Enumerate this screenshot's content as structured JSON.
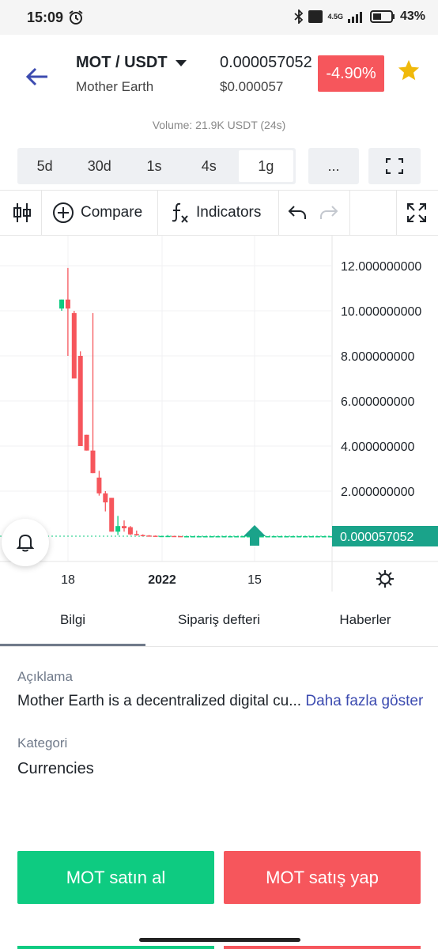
{
  "status": {
    "time": "15:09",
    "network": "4.5G",
    "battery": "43%"
  },
  "header": {
    "pair": "MOT / USDT",
    "name": "Mother Earth",
    "price": "0.000057052",
    "price_usd": "$0.000057",
    "change": "-4.90%",
    "volume": "Volume: 21.9K USDT (24s)"
  },
  "timeframes": [
    {
      "label": "5d"
    },
    {
      "label": "30d"
    },
    {
      "label": "1s"
    },
    {
      "label": "4s"
    },
    {
      "label": "1g",
      "active": true
    }
  ],
  "more_label": "...",
  "toolbar": {
    "compare": "Compare",
    "indicators": "Indicators"
  },
  "chart_data": {
    "type": "candlestick",
    "y_ticks": [
      "12.000000000",
      "10.000000000",
      "8.000000000",
      "6.000000000",
      "4.000000000",
      "2.000000000"
    ],
    "x_ticks": [
      "18",
      "2022",
      "15"
    ],
    "last_price_label": "0.000057052",
    "ylim": [
      0,
      12.8
    ],
    "candles": [
      {
        "o": 10.1,
        "h": 10.5,
        "l": 10.0,
        "c": 10.5
      },
      {
        "o": 10.5,
        "h": 11.9,
        "l": 8.0,
        "c": 10.1
      },
      {
        "o": 9.9,
        "h": 10.0,
        "l": 7.0,
        "c": 7.0
      },
      {
        "o": 8.0,
        "h": 8.2,
        "l": 4.0,
        "c": 4.0
      },
      {
        "o": 4.5,
        "h": 4.5,
        "l": 3.8,
        "c": 3.8
      },
      {
        "o": 3.8,
        "h": 9.9,
        "l": 2.8,
        "c": 2.8
      },
      {
        "o": 2.6,
        "h": 2.9,
        "l": 1.8,
        "c": 1.9
      },
      {
        "o": 1.9,
        "h": 2.0,
        "l": 1.1,
        "c": 1.5
      },
      {
        "o": 1.7,
        "h": 1.7,
        "l": 0.2,
        "c": 0.2
      },
      {
        "o": 0.2,
        "h": 0.9,
        "l": 0.05,
        "c": 0.45
      },
      {
        "o": 0.45,
        "h": 0.7,
        "l": 0.2,
        "c": 0.35
      },
      {
        "o": 0.4,
        "h": 0.45,
        "l": 0.05,
        "c": 0.08
      },
      {
        "o": 0.1,
        "h": 0.25,
        "l": 0.02,
        "c": 0.05
      },
      {
        "o": 0.05,
        "h": 0.08,
        "l": 0.02,
        "c": 0.03
      },
      {
        "o": 0.03,
        "h": 0.05,
        "l": 0.01,
        "c": 0.02
      },
      {
        "o": 0.02,
        "h": 0.03,
        "l": 0.01,
        "c": 0.01
      },
      {
        "o": 0.01,
        "h": 0.02,
        "l": 0.0,
        "c": 0.01
      },
      {
        "o": 0.01,
        "h": 0.05,
        "l": 0.0,
        "c": 0.01
      },
      {
        "o": 0.01,
        "h": 0.01,
        "l": 0.0,
        "c": 0.005
      },
      {
        "o": 0.005,
        "h": 0.006,
        "l": 0.0,
        "c": 0.0
      },
      {
        "o": 0.0,
        "h": 0.0,
        "l": 0.0,
        "c": 0.0
      },
      {
        "o": 0.0,
        "h": 0.0,
        "l": 0.0,
        "c": 0.0
      },
      {
        "o": 0.0,
        "h": 0.0,
        "l": 0.0,
        "c": 0.0
      },
      {
        "o": 0.0,
        "h": 0.0,
        "l": 0.0,
        "c": 0.0
      },
      {
        "o": 0.0,
        "h": 0.0,
        "l": 0.0,
        "c": 0.0
      },
      {
        "o": 0.0,
        "h": 0.0,
        "l": 0.0,
        "c": 0.0
      },
      {
        "o": 0.0,
        "h": 0.0,
        "l": 0.0,
        "c": 0.0
      },
      {
        "o": 0.0,
        "h": 0.0,
        "l": 0.0,
        "c": 0.0
      },
      {
        "o": 0.0,
        "h": 0.0,
        "l": 0.0,
        "c": 0.0
      },
      {
        "o": 0.0,
        "h": 0.0,
        "l": 0.0,
        "c": 0.0
      },
      {
        "o": 0.0,
        "h": 0.0,
        "l": 0.0,
        "c": 0.0
      },
      {
        "o": 0.0,
        "h": 0.0,
        "l": 0.0,
        "c": 0.0
      },
      {
        "o": 0.0,
        "h": 0.0,
        "l": 0.0,
        "c": 0.0
      },
      {
        "o": 0.0,
        "h": 0.0,
        "l": 0.0,
        "c": 0.0
      },
      {
        "o": 0.0,
        "h": 0.0,
        "l": 0.0,
        "c": 0.0
      },
      {
        "o": 0.0,
        "h": 0.0,
        "l": 0.0,
        "c": 0.0
      },
      {
        "o": 0.0,
        "h": 0.0,
        "l": 0.0,
        "c": 0.0
      },
      {
        "o": 0.0,
        "h": 0.0,
        "l": 0.0,
        "c": 0.0
      },
      {
        "o": 0.0,
        "h": 0.0,
        "l": 0.0,
        "c": 0.0
      },
      {
        "o": 0.0,
        "h": 0.0,
        "l": 0.0,
        "c": 0.0
      },
      {
        "o": 0.0,
        "h": 0.0,
        "l": 0.0,
        "c": 0.0
      },
      {
        "o": 0.0,
        "h": 0.0,
        "l": 0.0,
        "c": 0.0
      },
      {
        "o": 0.0,
        "h": 0.0,
        "l": 0.0,
        "c": 0.0
      },
      {
        "o": 0.0,
        "h": 0.0,
        "l": 0.0,
        "c": 0.0
      },
      {
        "o": 0.0,
        "h": 0.0,
        "l": 0.0,
        "c": 0.0
      },
      {
        "o": 0.0,
        "h": 0.0,
        "l": 0.0,
        "c": 0.0
      }
    ],
    "up_color": "#0ecb81",
    "down_color": "#f6565c"
  },
  "tabs": [
    "Bilgi",
    "Sipariş defteri",
    "Haberler"
  ],
  "info": {
    "desc_label": "Açıklama",
    "desc_text": "Mother Earth is a decentralized digital cu...",
    "more_link": "Daha fazla göster",
    "category_label": "Kategori",
    "category_value": "Currencies"
  },
  "actions": {
    "buy": "MOT satın al",
    "sell": "MOT satış yap"
  },
  "colors": {
    "buy": "#0ecb81",
    "sell": "#f6565c",
    "accent": "#3c4bb0",
    "star": "#f0b90b"
  }
}
